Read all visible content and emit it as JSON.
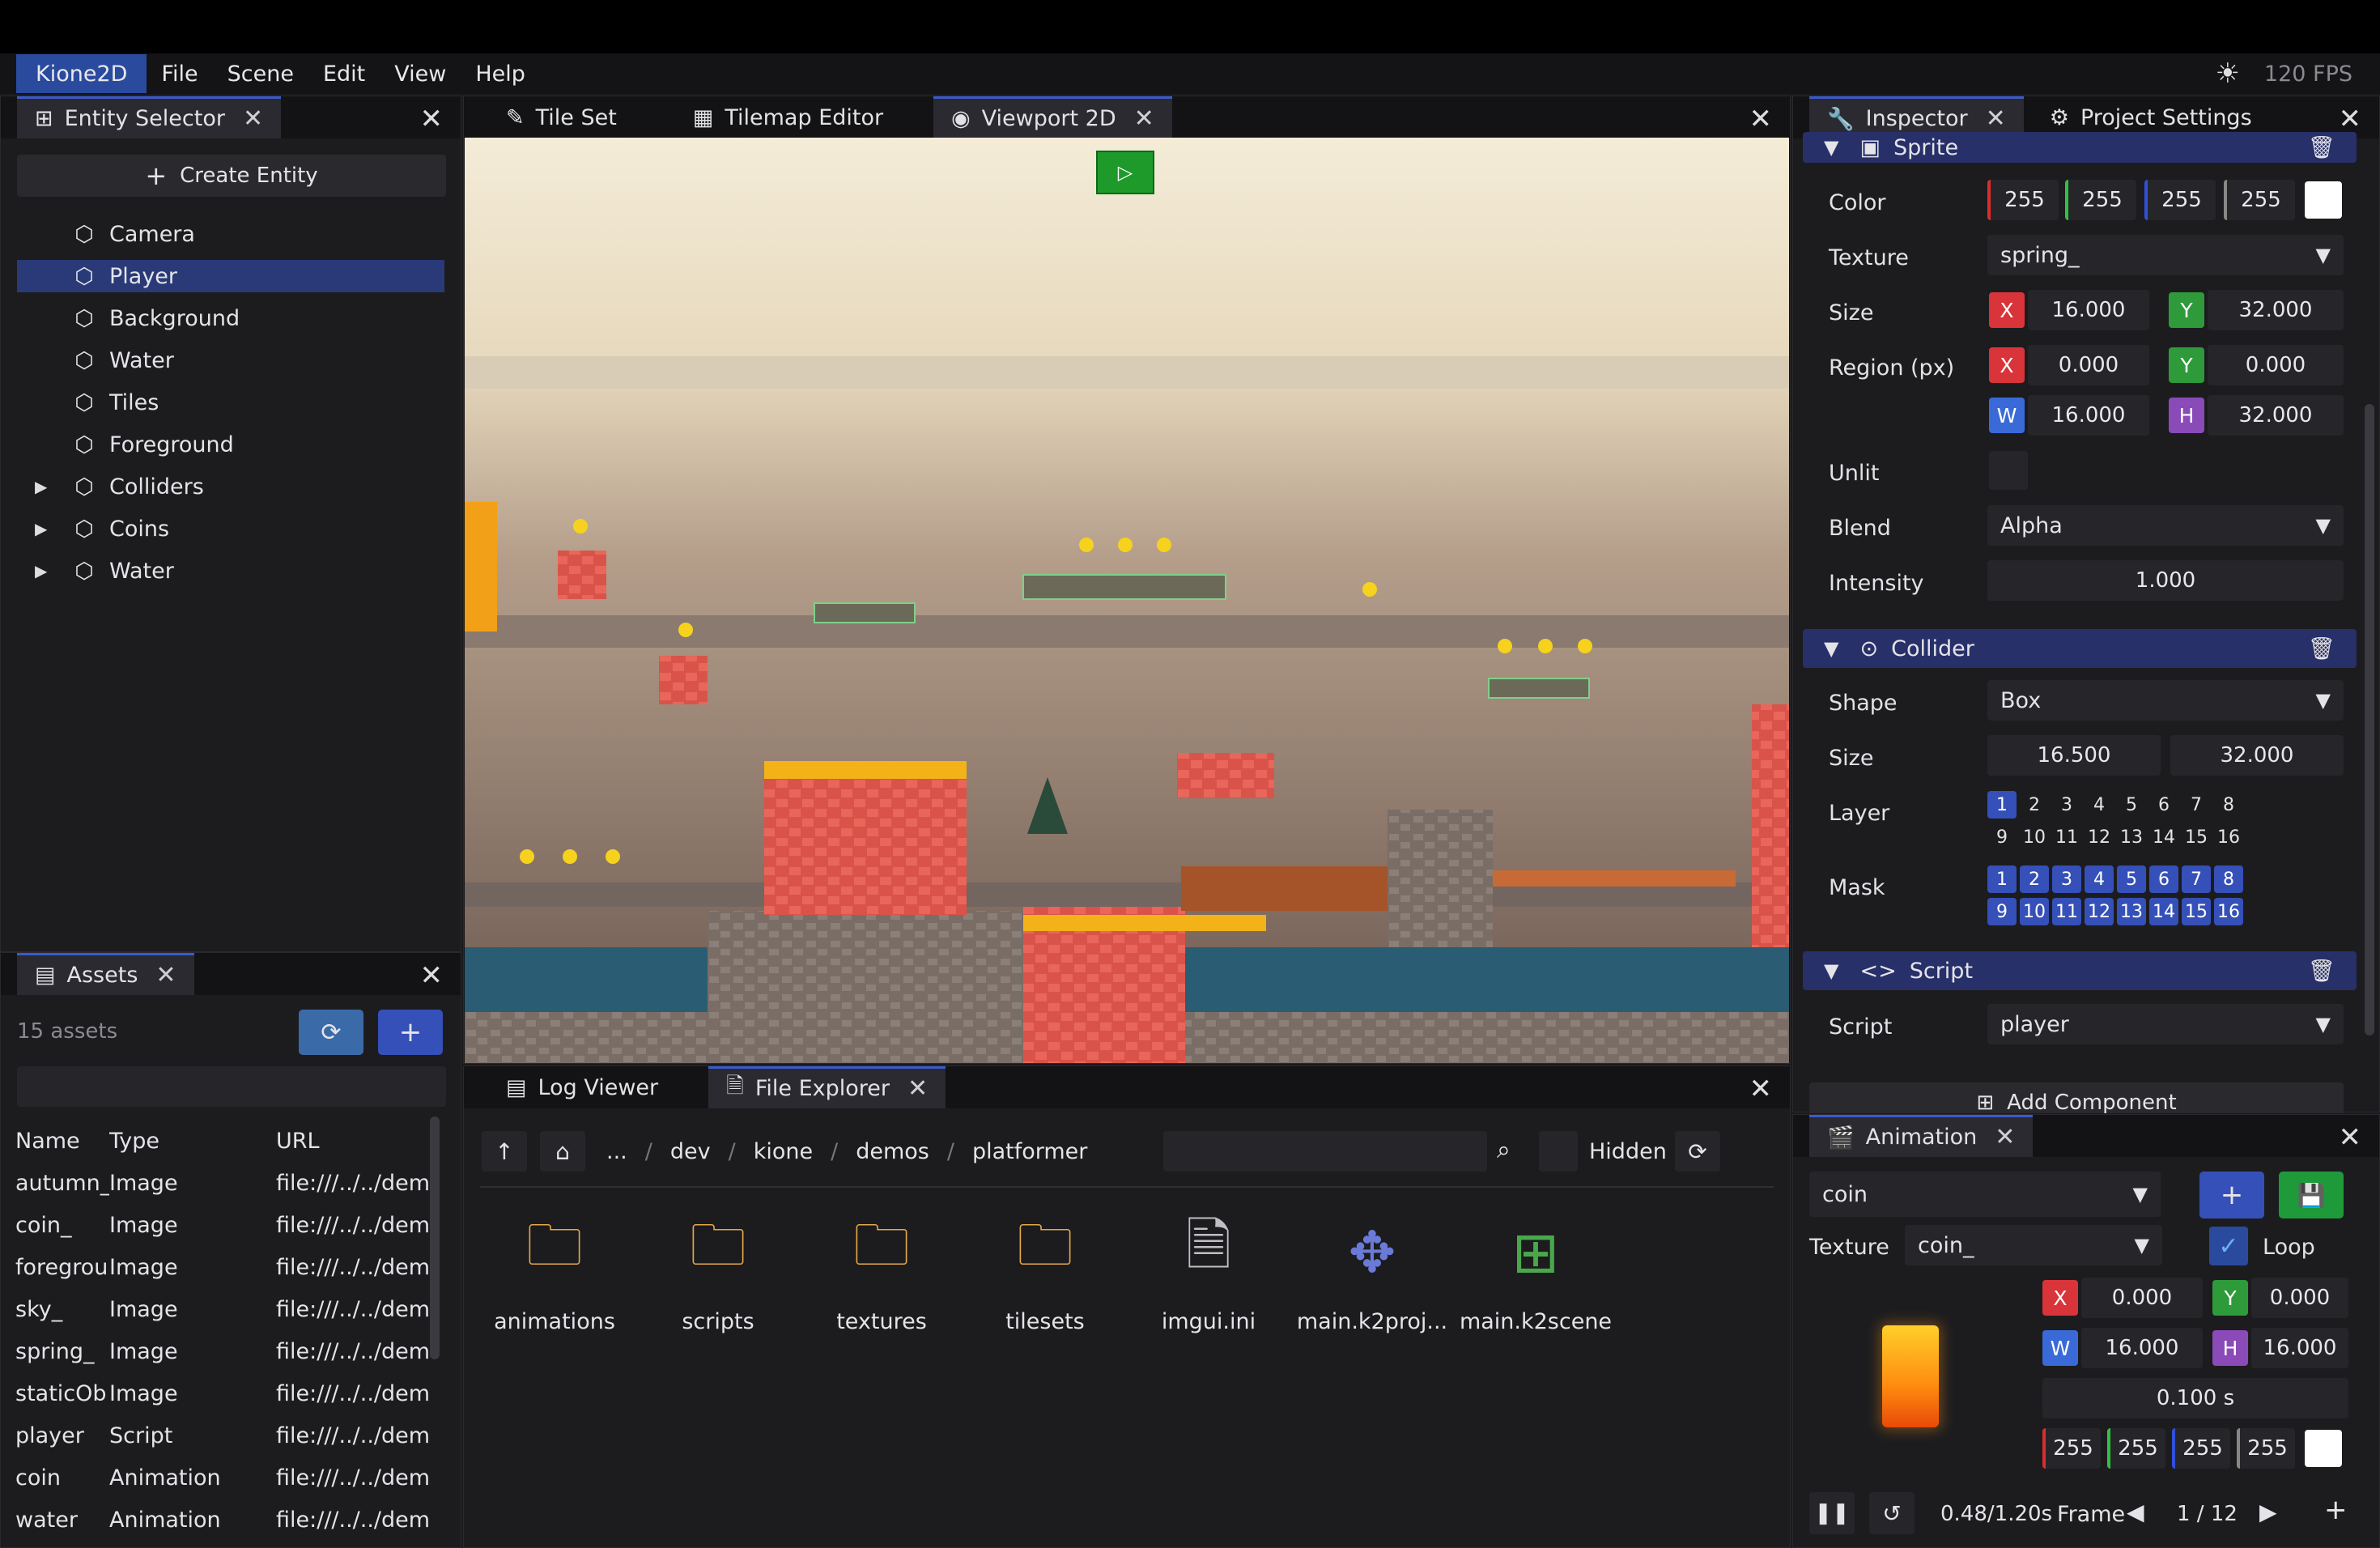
{
  "app": {
    "brand": "Kione2D",
    "fps": "120 FPS"
  },
  "menu": [
    "File",
    "Scene",
    "Edit",
    "View",
    "Help"
  ],
  "entity_panel": {
    "tab": "Entity Selector",
    "create_label": "Create Entity",
    "items": [
      {
        "label": "Camera",
        "expandable": false,
        "selected": false
      },
      {
        "label": "Player",
        "expandable": false,
        "selected": true
      },
      {
        "label": "Background",
        "expandable": false,
        "selected": false
      },
      {
        "label": "Water",
        "expandable": false,
        "selected": false
      },
      {
        "label": "Tiles",
        "expandable": false,
        "selected": false
      },
      {
        "label": "Foreground",
        "expandable": false,
        "selected": false
      },
      {
        "label": "Colliders",
        "expandable": true,
        "selected": false
      },
      {
        "label": "Coins",
        "expandable": true,
        "selected": false
      },
      {
        "label": "Water",
        "expandable": true,
        "selected": false
      }
    ]
  },
  "center_tabs": [
    "Tile Set",
    "Tilemap Editor",
    "Viewport 2D"
  ],
  "assets_panel": {
    "tab": "Assets",
    "count": "15 assets",
    "columns": [
      "Name",
      "Type",
      "URL"
    ],
    "rows": [
      [
        "autumn_",
        "Image",
        "file:///../../dem"
      ],
      [
        "coin_",
        "Image",
        "file:///../../dem"
      ],
      [
        "foregrou",
        "Image",
        "file:///../../dem"
      ],
      [
        "sky_",
        "Image",
        "file:///../../dem"
      ],
      [
        "spring_",
        "Image",
        "file:///../../dem"
      ],
      [
        "staticOb",
        "Image",
        "file:///../../dem"
      ],
      [
        "player",
        "Script",
        "file:///../../dem"
      ],
      [
        "coin",
        "Animation",
        "file:///../../dem"
      ],
      [
        "water",
        "Animation",
        "file:///../../dem"
      ]
    ]
  },
  "bottom_tabs": [
    "Log Viewer",
    "File Explorer"
  ],
  "explorer": {
    "path": [
      "...",
      "dev",
      "kione",
      "demos",
      "platformer"
    ],
    "hidden_label": "Hidden",
    "items": [
      {
        "name": "animations",
        "kind": "folder"
      },
      {
        "name": "scripts",
        "kind": "folder"
      },
      {
        "name": "textures",
        "kind": "folder"
      },
      {
        "name": "tilesets",
        "kind": "folder"
      },
      {
        "name": "imgui.ini",
        "kind": "file"
      },
      {
        "name": "main.k2proj...",
        "kind": "project"
      },
      {
        "name": "main.k2scene",
        "kind": "scene"
      }
    ]
  },
  "inspector": {
    "tabs": [
      "Inspector",
      "Project Settings"
    ],
    "sprite": {
      "title": "Sprite",
      "color_label": "Color",
      "color": [
        "255",
        "255",
        "255",
        "255"
      ],
      "texture_label": "Texture",
      "texture": "spring_",
      "size_label": "Size",
      "size": [
        "16.000",
        "32.000"
      ],
      "region_label": "Region (px)",
      "region_xy": [
        "0.000",
        "0.000"
      ],
      "region_wh": [
        "16.000",
        "32.000"
      ],
      "unlit_label": "Unlit",
      "blend_label": "Blend",
      "blend": "Alpha",
      "intensity_label": "Intensity",
      "intensity": "1.000"
    },
    "collider": {
      "title": "Collider",
      "shape_label": "Shape",
      "shape": "Box",
      "size_label": "Size",
      "size": [
        "16.500",
        "32.000"
      ],
      "layer_label": "Layer",
      "mask_label": "Mask",
      "numbers": [
        "1",
        "2",
        "3",
        "4",
        "5",
        "6",
        "7",
        "8",
        "9",
        "10",
        "11",
        "12",
        "13",
        "14",
        "15",
        "16"
      ]
    },
    "script": {
      "title": "Script",
      "script_label": "Script",
      "value": "player"
    },
    "add_component": "Add Component"
  },
  "animation": {
    "tab": "Animation",
    "selected": "coin",
    "texture_label": "Texture",
    "texture": "coin_",
    "loop_label": "Loop",
    "xy": [
      "0.000",
      "0.000"
    ],
    "wh": [
      "16.000",
      "16.000"
    ],
    "duration": "0.100 s",
    "color": [
      "255",
      "255",
      "255",
      "255"
    ],
    "time": "0.48/1.20s",
    "frame_label": "Frame",
    "frame": "1 / 12"
  },
  "axis_labels": {
    "x": "X",
    "y": "Y",
    "w": "W",
    "h": "H"
  },
  "colors": {
    "accent": "#3550b8",
    "selected": "#2a3a78",
    "section": "#28306a",
    "play": "#1e9a2a",
    "save": "#1e9a3a"
  }
}
